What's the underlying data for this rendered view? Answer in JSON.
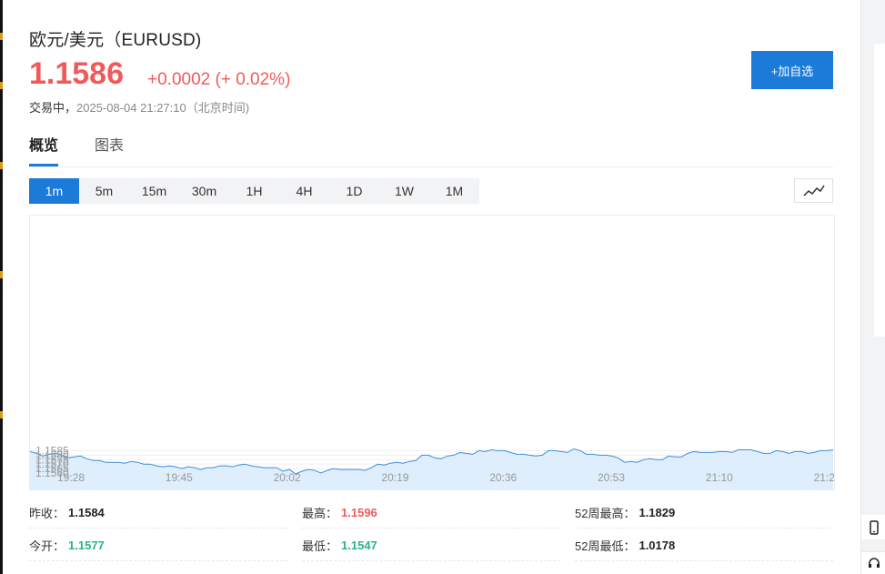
{
  "header": {
    "title": "欧元/美元（EURUSD)",
    "price": "1.1586",
    "change": "+0.0002 (+ 0.02%)",
    "status": "交易中，",
    "timestamp": "2025-08-04 21:27:10（北京时间)",
    "watch_label": "+加自选"
  },
  "tabs": [
    {
      "label": "概览",
      "active": true
    },
    {
      "label": "图表",
      "active": false
    }
  ],
  "periods": [
    {
      "label": "1m",
      "active": true
    },
    {
      "label": "5m"
    },
    {
      "label": "15m"
    },
    {
      "label": "30m"
    },
    {
      "label": "1H"
    },
    {
      "label": "4H"
    },
    {
      "label": "1D"
    },
    {
      "label": "1W"
    },
    {
      "label": "1M"
    }
  ],
  "chart_data": {
    "type": "area",
    "title": "",
    "xlabel": "",
    "ylabel": "",
    "ylim": [
      1.1559,
      1.1591
    ],
    "y_ticks": [
      "1.1585",
      "1.1580",
      "1.1575",
      "1.1570",
      "1.1565",
      "1.1560"
    ],
    "x_ticks": [
      "19:28",
      "19:45",
      "20:02",
      "20:19",
      "20:36",
      "20:53",
      "21:10",
      "21:2"
    ],
    "colors": {
      "line": "#3d8fdc",
      "fill": "#deeefc"
    },
    "series": [
      {
        "values": [
          1.1584,
          1.1582,
          1.1579,
          1.1581,
          1.1582,
          1.158,
          1.1577,
          1.1578,
          1.1579,
          1.1576,
          1.1574,
          1.1574,
          1.1572,
          1.1572,
          1.1572,
          1.1571,
          1.1573,
          1.1572,
          1.157,
          1.157,
          1.1568,
          1.1567,
          1.1568,
          1.1567,
          1.1565,
          1.1567,
          1.1566,
          1.1564,
          1.1566,
          1.1566,
          1.1568,
          1.1568,
          1.1567,
          1.1569,
          1.157,
          1.1568,
          1.1567,
          1.1566,
          1.1566,
          1.1566,
          1.1562,
          1.1564,
          1.1559,
          1.1562,
          1.1564,
          1.1563,
          1.156,
          1.1563,
          1.1565,
          1.1564,
          1.1564,
          1.1564,
          1.1564,
          1.1563,
          1.1566,
          1.157,
          1.1569,
          1.1571,
          1.1572,
          1.1571,
          1.1573,
          1.1574,
          1.158,
          1.158,
          1.1577,
          1.1576,
          1.1579,
          1.158,
          1.1583,
          1.1582,
          1.1581,
          1.1585,
          1.1584,
          1.1586,
          1.1585,
          1.1585,
          1.1583,
          1.1581,
          1.1581,
          1.158,
          1.1579,
          1.158,
          1.1585,
          1.1585,
          1.1584,
          1.1583,
          1.1587,
          1.1585,
          1.1581,
          1.1581,
          1.158,
          1.158,
          1.1579,
          1.1577,
          1.1572,
          1.1573,
          1.1572,
          1.1575,
          1.1576,
          1.1575,
          1.1575,
          1.1579,
          1.1578,
          1.1578,
          1.1582,
          1.1584,
          1.1583,
          1.1583,
          1.1583,
          1.1584,
          1.1584,
          1.1583,
          1.1586,
          1.1586,
          1.1586,
          1.1584,
          1.1582,
          1.1582,
          1.1585,
          1.1584,
          1.1582,
          1.1584,
          1.1584,
          1.1582,
          1.1583,
          1.1585,
          1.1585,
          1.1586
        ]
      }
    ]
  },
  "stats": [
    {
      "label": "昨收：",
      "value": "1.1584",
      "tone": "neutral"
    },
    {
      "label": "最高：",
      "value": "1.1596",
      "tone": "up"
    },
    {
      "label": "52周最高：",
      "value": "1.1829",
      "tone": "neutral"
    },
    {
      "label": "今开：",
      "value": "1.1577",
      "tone": "down"
    },
    {
      "label": "最低：",
      "value": "1.1547",
      "tone": "down"
    },
    {
      "label": "52周最低：",
      "value": "1.0178",
      "tone": "neutral"
    }
  ],
  "icons": {
    "mobile": "mobile-phone-icon",
    "headset": "headset-icon",
    "line_chart": "line-chart-icon"
  }
}
